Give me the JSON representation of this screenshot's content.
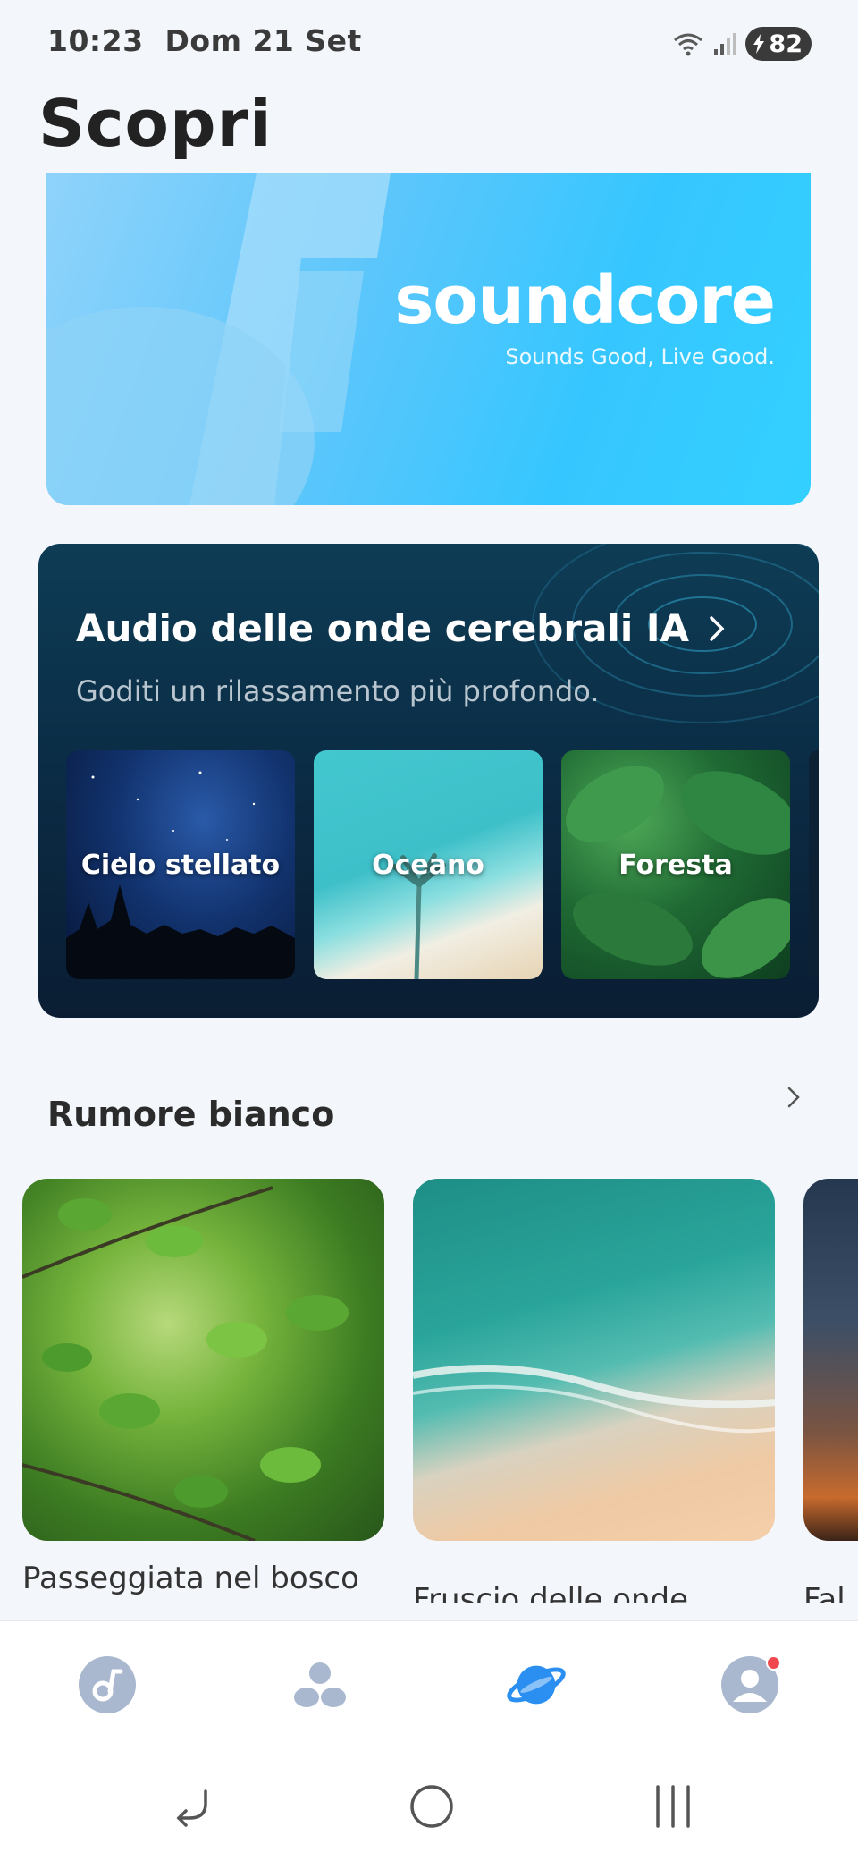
{
  "status_bar": {
    "time": "10:23",
    "date": "Dom 21 Set",
    "battery": "82"
  },
  "page": {
    "title": "Scopri"
  },
  "banner": {
    "logo_text": "soundcore",
    "tagline": "Sounds Good, Live Good.",
    "accent_color": "#36c6ff"
  },
  "ai_audio": {
    "title": "Audio delle onde cerebrali IA",
    "subtitle": "Goditi un rilassamento più profondo.",
    "tiles": [
      {
        "label": "Cielo stellato"
      },
      {
        "label": "Oceano"
      },
      {
        "label": "Foresta"
      }
    ]
  },
  "white_noise": {
    "title": "Rumore bianco",
    "items": [
      {
        "label": "Passeggiata nel bosco"
      },
      {
        "label": "Fruscio delle onde"
      },
      {
        "label": "Fal"
      }
    ]
  },
  "bottom_nav": {
    "active_color": "#2a8ff0",
    "inactive_color": "#a9b8cf",
    "items": [
      {
        "icon": "music-note-icon"
      },
      {
        "icon": "community-icon"
      },
      {
        "icon": "planet-icon"
      },
      {
        "icon": "profile-icon"
      }
    ]
  },
  "system_nav": {
    "items": [
      {
        "icon": "back-icon"
      },
      {
        "icon": "home-icon"
      },
      {
        "icon": "recents-icon"
      }
    ]
  }
}
